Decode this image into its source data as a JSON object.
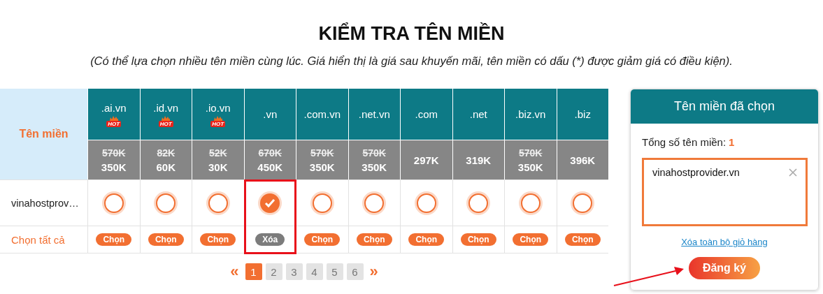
{
  "title": "KIỂM TRA TÊN MIỀN",
  "subtitle": "(Có thể lựa chọn nhiều tên miền cùng lúc. Giá hiển thị là giá sau khuyến mãi, tên miền có dấu (*) được giảm giá có điều kiện).",
  "table": {
    "corner_label": "Tên miền",
    "columns": [
      {
        "tld": ".ai.vn",
        "hot": true,
        "hot_label": "HOT",
        "old_price": "570K",
        "price": "350K",
        "highlighted": false
      },
      {
        "tld": ".id.vn",
        "hot": true,
        "hot_label": "HOT",
        "old_price": "82K",
        "price": "60K",
        "highlighted": false
      },
      {
        "tld": ".io.vn",
        "hot": true,
        "hot_label": "HOT",
        "old_price": "52K",
        "price": "30K",
        "highlighted": false
      },
      {
        "tld": ".vn",
        "hot": false,
        "old_price": "670K",
        "price": "450K",
        "highlighted": true
      },
      {
        "tld": ".com.vn",
        "hot": false,
        "old_price": "570K",
        "price": "350K",
        "highlighted": false
      },
      {
        "tld": ".net.vn",
        "hot": false,
        "old_price": "570K",
        "price": "350K",
        "highlighted": false
      },
      {
        "tld": ".com",
        "hot": false,
        "price": "297K",
        "highlighted": false
      },
      {
        "tld": ".net",
        "hot": false,
        "price": "319K",
        "highlighted": false
      },
      {
        "tld": ".biz.vn",
        "hot": false,
        "old_price": "570K",
        "price": "350K",
        "highlighted": false
      },
      {
        "tld": ".biz",
        "hot": false,
        "price": "396K",
        "highlighted": false
      }
    ],
    "rows": [
      {
        "domain": "vinahostprov…",
        "checks": [
          {
            "checked": false
          },
          {
            "checked": false
          },
          {
            "checked": false
          },
          {
            "checked": true
          },
          {
            "checked": false
          },
          {
            "checked": false
          },
          {
            "checked": false
          },
          {
            "checked": false
          },
          {
            "checked": false
          },
          {
            "checked": false
          }
        ]
      }
    ],
    "select_all_label": "Chọn tất cả",
    "actions": [
      {
        "label": "Chọn",
        "kind": "select"
      },
      {
        "label": "Chọn",
        "kind": "select"
      },
      {
        "label": "Chọn",
        "kind": "select"
      },
      {
        "label": "Xóa",
        "kind": "remove"
      },
      {
        "label": "Chọn",
        "kind": "select"
      },
      {
        "label": "Chọn",
        "kind": "select"
      },
      {
        "label": "Chọn",
        "kind": "select"
      },
      {
        "label": "Chọn",
        "kind": "select"
      },
      {
        "label": "Chọn",
        "kind": "select"
      },
      {
        "label": "Chọn",
        "kind": "select"
      }
    ]
  },
  "pagination": {
    "prev": "«",
    "next": "»",
    "pages": [
      {
        "label": "1",
        "selected": true
      },
      {
        "label": "2",
        "selected": false
      },
      {
        "label": "3",
        "selected": false
      },
      {
        "label": "4",
        "selected": false
      },
      {
        "label": "5",
        "selected": false
      },
      {
        "label": "6",
        "selected": false
      }
    ]
  },
  "cart": {
    "title": "Tên miền đã chọn",
    "total_label": "Tổng số tên miền:",
    "total_count": "1",
    "items": [
      {
        "domain": "vinahostprovider.vn"
      }
    ],
    "clear_link": "Xóa toàn bộ giỏ hàng",
    "register_button": "Đăng ký"
  },
  "annotation_arrow": true
}
